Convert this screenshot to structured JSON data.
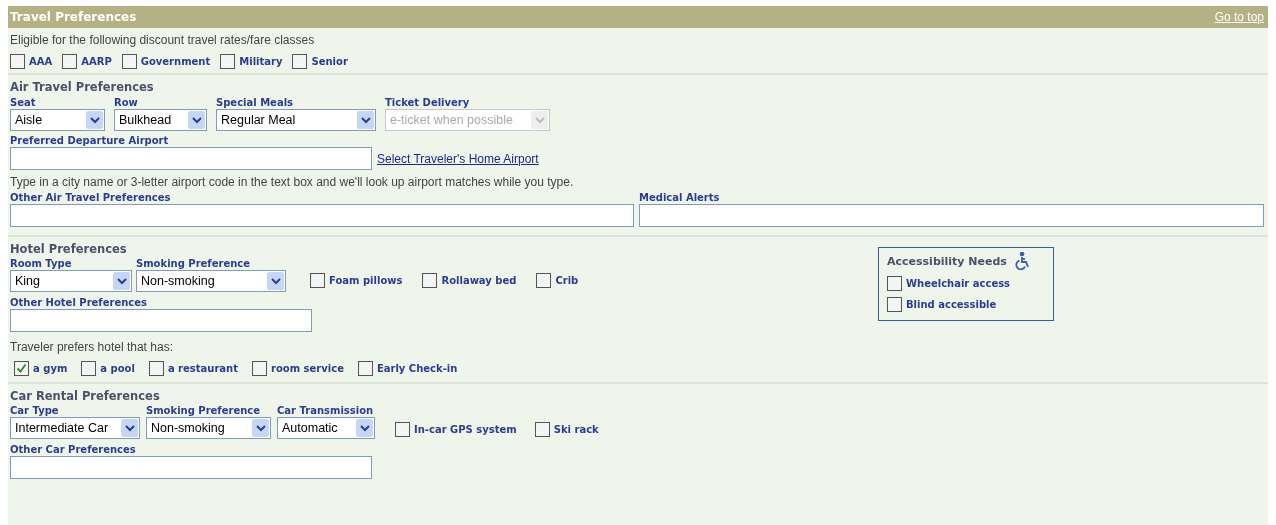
{
  "header": {
    "title": "Travel Preferences",
    "link": "Go to top"
  },
  "discounts": {
    "label": "Eligible for the following discount travel rates/fare classes",
    "options": [
      {
        "label": "AAA",
        "checked": false
      },
      {
        "label": "AARP",
        "checked": false
      },
      {
        "label": "Government",
        "checked": false
      },
      {
        "label": "Military",
        "checked": false
      },
      {
        "label": "Senior",
        "checked": false
      }
    ]
  },
  "air": {
    "title": "Air Travel Preferences",
    "selects": [
      {
        "label": "Seat",
        "value": "Aisle",
        "disabled": false
      },
      {
        "label": "Row",
        "value": "Bulkhead",
        "disabled": false
      },
      {
        "label": "Special Meals",
        "value": "Regular Meal",
        "disabled": false
      },
      {
        "label": "Ticket Delivery",
        "value": "e-ticket when possible",
        "disabled": true
      }
    ],
    "departure": {
      "label": "Preferred Departure Airport",
      "link": "Select Traveler's Home Airport"
    },
    "hint": "Type in a city name or 3-letter airport code in the text box and we'll look up airport matches while you type.",
    "other": {
      "label": "Other Air Travel Preferences"
    },
    "medical": {
      "label": "Medical Alerts"
    }
  },
  "hotel": {
    "title": "Hotel Preferences",
    "selects": [
      {
        "label": "Room Type",
        "value": "King",
        "disabled": false
      },
      {
        "label": "Smoking Preference",
        "value": "Non-smoking",
        "disabled": false
      }
    ],
    "amenities": [
      {
        "label": "Foam pillows",
        "checked": false
      },
      {
        "label": "Rollaway bed",
        "checked": false
      },
      {
        "label": "Crib",
        "checked": false
      }
    ],
    "other": {
      "label": "Other Hotel Preferences"
    },
    "prefers": {
      "label": "Traveler prefers hotel that has:",
      "options": [
        {
          "label": "a gym",
          "checked": true
        },
        {
          "label": "a pool",
          "checked": false
        },
        {
          "label": "a restaurant",
          "checked": false
        },
        {
          "label": "room service",
          "checked": false
        },
        {
          "label": "Early Check-in",
          "checked": false
        }
      ]
    },
    "accessibility": {
      "title": "Accessibility Needs",
      "options": [
        {
          "label": "Wheelchair access",
          "checked": false
        },
        {
          "label": "Blind accessible",
          "checked": false
        }
      ]
    }
  },
  "car": {
    "title": "Car Rental Preferences",
    "selects": [
      {
        "label": "Car Type",
        "value": "Intermediate Car",
        "disabled": false
      },
      {
        "label": "Smoking Preference",
        "value": "Non-smoking",
        "disabled": false
      },
      {
        "label": "Car Transmission",
        "value": "Automatic",
        "disabled": false
      }
    ],
    "options": [
      {
        "label": "In-car GPS system",
        "checked": false
      },
      {
        "label": "Ski rack",
        "checked": false
      }
    ],
    "other": {
      "label": "Other Car Preferences"
    }
  }
}
